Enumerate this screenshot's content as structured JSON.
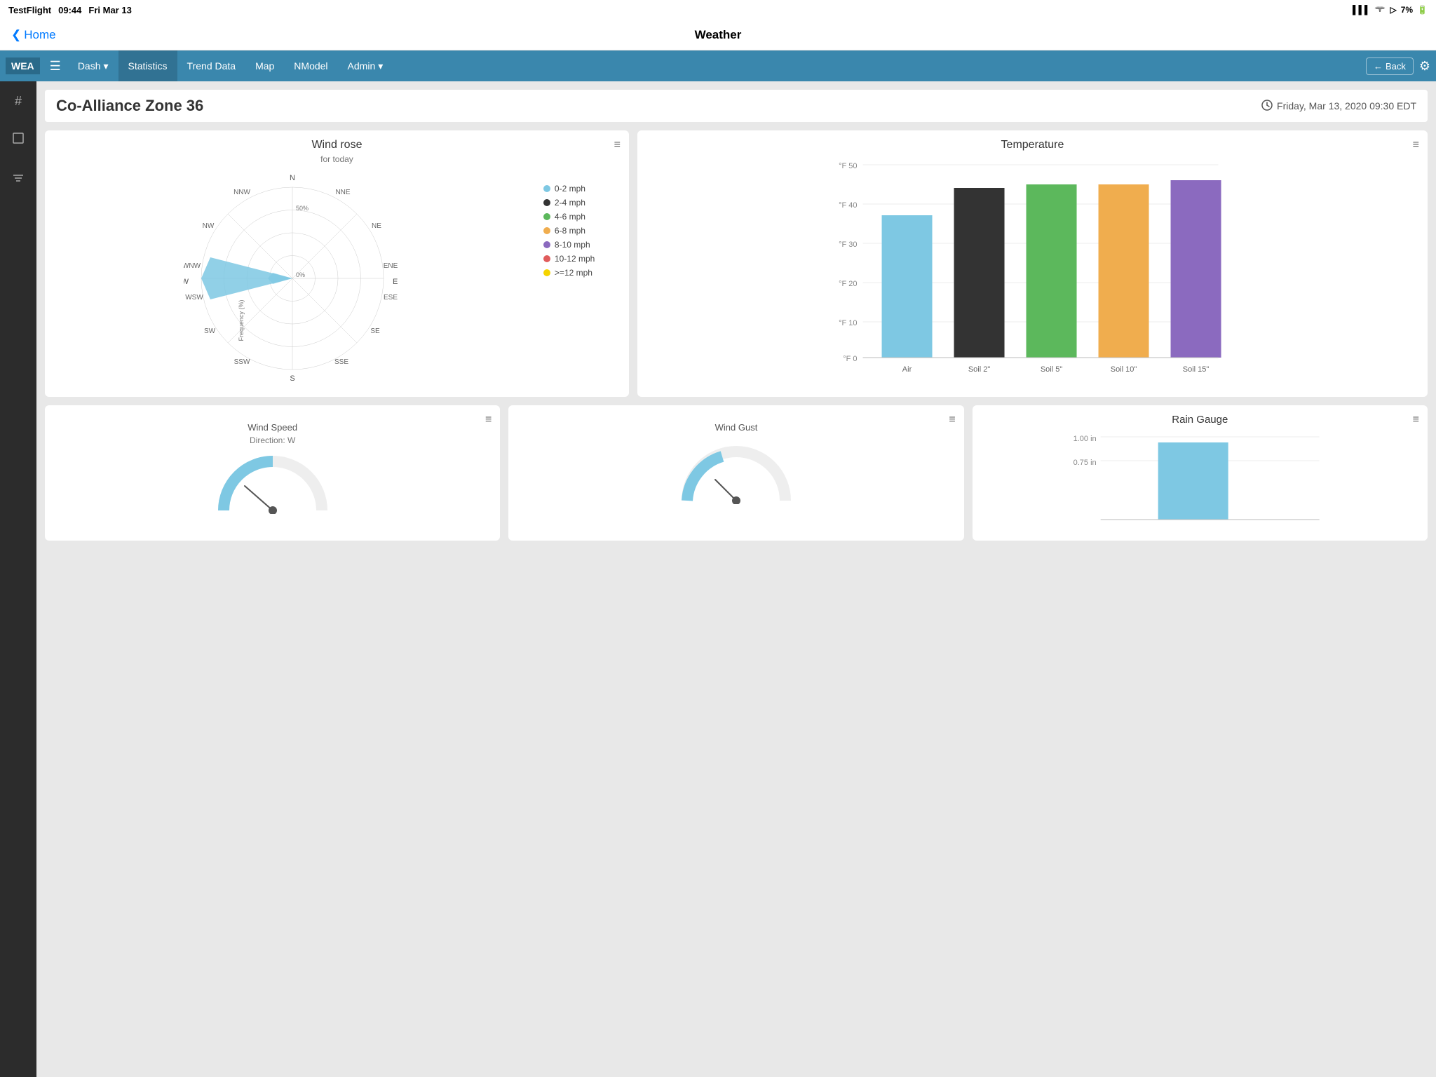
{
  "status_bar": {
    "app": "TestFlight",
    "time": "09:44",
    "day": "Fri Mar 13",
    "signal": "●●●",
    "wifi": "wifi",
    "battery": "7%"
  },
  "top_nav": {
    "home_label": "Home",
    "page_title": "Weather"
  },
  "app_header": {
    "logo": "WEA",
    "hamburger_label": "☰",
    "nav_items": [
      {
        "label": "Dash",
        "has_dropdown": true,
        "active": false
      },
      {
        "label": "Statistics",
        "has_dropdown": false,
        "active": true
      },
      {
        "label": "Trend Data",
        "has_dropdown": false,
        "active": false
      },
      {
        "label": "Map",
        "has_dropdown": false,
        "active": false
      },
      {
        "label": "NModel",
        "has_dropdown": false,
        "active": false
      },
      {
        "label": "Admin",
        "has_dropdown": true,
        "active": false
      }
    ],
    "back_label": "Back",
    "gear_label": "⚙"
  },
  "sidebar": {
    "icons": [
      {
        "name": "hash-icon",
        "symbol": "#"
      },
      {
        "name": "crop-icon",
        "symbol": "⊡"
      },
      {
        "name": "filter-icon",
        "symbol": "⊕"
      }
    ]
  },
  "page": {
    "zone_title": "Co-Alliance Zone 36",
    "date_time": "Friday, Mar 13, 2020 09:30 EDT"
  },
  "wind_rose": {
    "title": "Wind rose",
    "subtitle": "for today",
    "menu_label": "≡",
    "directions": [
      "N",
      "NNE",
      "NE",
      "ENE",
      "E",
      "ESE",
      "SE",
      "SSE",
      "S",
      "SSW",
      "SW",
      "WSW",
      "W",
      "WNW",
      "NW",
      "NNW"
    ],
    "rings": [
      "50%",
      "0%"
    ],
    "petal_label": "Frequency (%)",
    "legend": [
      {
        "label": "0-2 mph",
        "color": "#7ec8e3"
      },
      {
        "label": "2-4 mph",
        "color": "#333"
      },
      {
        "label": "4-6 mph",
        "color": "#5cb85c"
      },
      {
        "label": "6-8 mph",
        "color": "#f0ad4e"
      },
      {
        "label": "8-10 mph",
        "color": "#8b6abf"
      },
      {
        "label": "10-12 mph",
        "color": "#e05c5c"
      },
      {
        "label": ">=12 mph",
        "color": "#f5d400"
      }
    ]
  },
  "temperature": {
    "title": "Temperature",
    "menu_label": "≡",
    "y_labels": [
      "°F 50",
      "°F 40",
      "°F 30",
      "°F 20",
      "°F 10",
      "°F 0"
    ],
    "bars": [
      {
        "label": "Air",
        "value": 37,
        "color": "#7ec8e3",
        "height_pct": 74
      },
      {
        "label": "Soil 2\"",
        "value": 44,
        "color": "#333333",
        "height_pct": 88
      },
      {
        "label": "Soil 5\"",
        "value": 45,
        "color": "#5cb85c",
        "height_pct": 90
      },
      {
        "label": "Soil 10\"",
        "value": 45,
        "color": "#f0ad4e",
        "height_pct": 90
      },
      {
        "label": "Soil 15\"",
        "value": 46,
        "color": "#8b6abf",
        "height_pct": 92
      }
    ],
    "max_val": 50
  },
  "bottom_cards": [
    {
      "title": "Wind Speed",
      "subtitle": "Direction: W",
      "menu_label": "≡",
      "type": "gauge"
    },
    {
      "title": "Wind Gust",
      "subtitle": "",
      "menu_label": "≡",
      "type": "gauge"
    },
    {
      "title": "Rain Gauge",
      "menu_label": "≡",
      "type": "bar",
      "y_labels": [
        "1.00 in",
        "0.75 in"
      ],
      "bar_color": "#7ec8e3"
    }
  ]
}
